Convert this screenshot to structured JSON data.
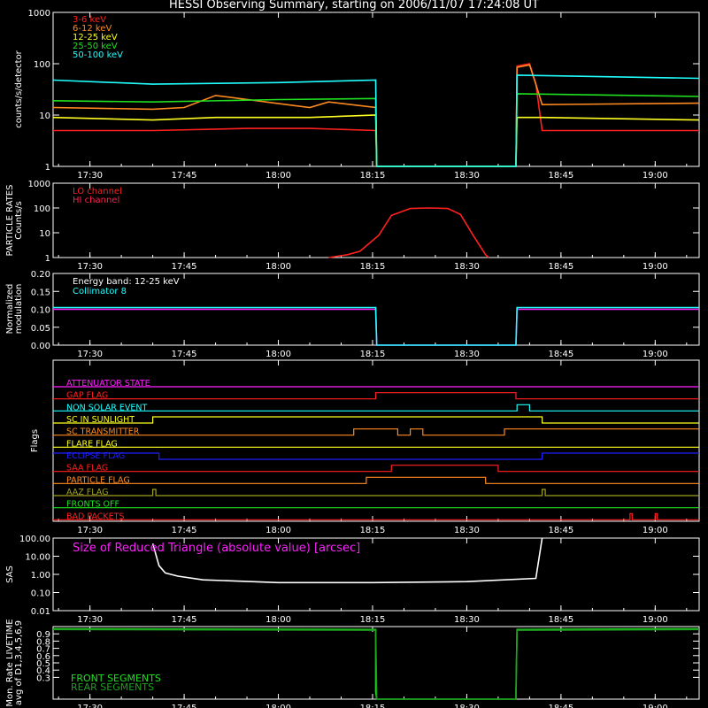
{
  "title": "HESSI Observing Summary, starting on 2006/11/07 17:24:08 UT",
  "colors": {
    "background": "#000000",
    "axes": "#ffffff",
    "red": "#ff2020",
    "orange": "#ff8a20",
    "yellow": "#ffff20",
    "green": "#20e020",
    "cyan": "#20ffff",
    "magenta": "#ff20ff",
    "blue": "#2020ff",
    "crimson": "#ff2050",
    "olive": "#a0a020",
    "darkgreen": "#20a020"
  },
  "time_axis": {
    "start": "17:24:08",
    "end": "19:07:00",
    "tick_labels": [
      "17:30",
      "17:45",
      "18:00",
      "18:15",
      "18:30",
      "18:45",
      "19:00"
    ]
  },
  "chart_data": [
    {
      "id": "count_rates",
      "type": "line",
      "ylabel": "counts/s/detector",
      "yscale": "log",
      "ylim": [
        1,
        1000
      ],
      "ytick_labels": [
        "1",
        "10",
        "100",
        "1000"
      ],
      "series": [
        {
          "name": "3-6 keV",
          "color": "red",
          "x": [
            "17:24:08",
            "17:33",
            "17:40",
            "17:55",
            "18:05",
            "18:15:30",
            "18:15:40",
            "18:37:50",
            "18:38",
            "18:40",
            "18:41",
            "18:42",
            "18:50",
            "19:07"
          ],
          "y": [
            5,
            5,
            5,
            5.5,
            5.5,
            5,
            1,
            1,
            90,
            100,
            40,
            5,
            5,
            5
          ]
        },
        {
          "name": "6-12 keV",
          "color": "orange",
          "x": [
            "17:24:08",
            "17:40",
            "17:45",
            "17:50",
            "18:05",
            "18:08",
            "18:15:30",
            "18:15:40",
            "18:37:50",
            "18:38",
            "18:40",
            "18:41",
            "18:42",
            "19:07"
          ],
          "y": [
            14,
            13,
            14,
            24,
            14,
            18,
            14,
            1,
            1,
            85,
            95,
            40,
            16,
            17
          ]
        },
        {
          "name": "12-25 keV",
          "color": "yellow",
          "x": [
            "17:24:08",
            "17:40",
            "17:50",
            "18:05",
            "18:15:30",
            "18:15:40",
            "18:37:50",
            "18:38",
            "18:42",
            "19:07"
          ],
          "y": [
            9,
            8,
            9,
            9,
            10,
            1,
            1,
            9,
            9,
            8
          ]
        },
        {
          "name": "25-50 keV",
          "color": "green",
          "x": [
            "17:24:08",
            "17:40",
            "18:00",
            "18:15:30",
            "18:15:40",
            "18:37:50",
            "18:38",
            "19:07"
          ],
          "y": [
            19,
            18,
            20,
            21,
            1,
            1,
            26,
            23
          ]
        },
        {
          "name": "50-100 keV",
          "color": "cyan",
          "x": [
            "17:24:08",
            "17:40",
            "18:00",
            "18:15:30",
            "18:15:40",
            "18:37:50",
            "18:38",
            "19:07"
          ],
          "y": [
            48,
            40,
            43,
            48,
            1,
            1,
            60,
            52
          ]
        }
      ]
    },
    {
      "id": "particle_rates",
      "type": "line",
      "ylabel": "PARTICLE RATES",
      "ylabel2": "Counts/s",
      "yscale": "log",
      "ylim": [
        1,
        1000
      ],
      "ytick_labels": [
        "1",
        "10",
        "100",
        "1000"
      ],
      "series": [
        {
          "name": "LO channel",
          "color": "red",
          "x": [
            "18:08",
            "18:11",
            "18:13",
            "18:16",
            "18:18",
            "18:21",
            "18:24",
            "18:27",
            "18:29",
            "18:31",
            "18:33",
            "18:33:30"
          ],
          "y": [
            1,
            1.3,
            1.8,
            8,
            50,
            95,
            100,
            95,
            55,
            8,
            1.3,
            1
          ]
        },
        {
          "name": "HI channel",
          "color": "crimson",
          "x": [],
          "y": []
        }
      ]
    },
    {
      "id": "modulation",
      "type": "line",
      "ylabel": "Normalized",
      "ylabel2": "modulation",
      "ylim": [
        0,
        0.2
      ],
      "ytick_labels": [
        "0.00",
        "0.05",
        "0.10",
        "0.15",
        "0.20"
      ],
      "series": [
        {
          "name": "Energy band: 12-25 keV",
          "color": "magenta",
          "x": [
            "17:24:08",
            "18:15:30",
            "18:15:40",
            "18:37:50",
            "18:38",
            "19:07"
          ],
          "y": [
            0.1,
            0.1,
            0,
            0,
            0.1,
            0.1
          ]
        },
        {
          "name": "Collimator 8",
          "color": "cyan",
          "x": [
            "17:24:08",
            "18:15:30",
            "18:15:40",
            "18:37:50",
            "18:38",
            "19:07"
          ],
          "y": [
            0.105,
            0.105,
            0,
            0,
            0.105,
            0.105
          ]
        }
      ]
    },
    {
      "id": "flags",
      "type": "line",
      "ylabel": "Flags",
      "series": [
        {
          "name": "ATTENUATOR STATE",
          "color": "magenta",
          "x": [
            "17:24:08",
            "19:07"
          ],
          "y": [
            0,
            0
          ]
        },
        {
          "name": "GAP FLAG",
          "color": "red",
          "x": [
            "17:24:08",
            "18:15:30",
            "18:15:30",
            "18:37:50",
            "18:37:50",
            "19:07"
          ],
          "y": [
            0,
            0,
            1,
            1,
            0,
            0
          ]
        },
        {
          "name": "NON SOLAR EVENT",
          "color": "cyan",
          "x": [
            "17:24:08",
            "18:38",
            "18:38",
            "18:40",
            "18:40",
            "19:07"
          ],
          "y": [
            0,
            0,
            1,
            1,
            0,
            0
          ]
        },
        {
          "name": "SC IN SUNLIGHT",
          "color": "yellow",
          "x": [
            "17:24:08",
            "17:40",
            "17:40",
            "18:42",
            "18:42",
            "19:07"
          ],
          "y": [
            0,
            0,
            1,
            1,
            0,
            0
          ]
        },
        {
          "name": "SC TRANSMITTER",
          "color": "orange",
          "x": [
            "17:24:08",
            "18:12",
            "18:12",
            "18:19",
            "18:19",
            "18:21",
            "18:21",
            "18:23",
            "18:23",
            "18:36",
            "18:36",
            "19:07"
          ],
          "y": [
            0,
            0,
            1,
            1,
            0,
            0,
            1,
            1,
            0,
            0,
            1,
            1
          ]
        },
        {
          "name": "FLARE FLAG",
          "color": "yellow",
          "x": [
            "17:24:08",
            "19:07"
          ],
          "y": [
            0,
            0
          ]
        },
        {
          "name": "ECLIPSE FLAG",
          "color": "blue",
          "x": [
            "17:24:08",
            "17:41",
            "17:41",
            "18:42",
            "18:42",
            "19:07"
          ],
          "y": [
            1,
            1,
            0,
            0,
            1,
            1
          ]
        },
        {
          "name": "SAA FLAG",
          "color": "red",
          "x": [
            "17:24:08",
            "18:18",
            "18:18",
            "18:35",
            "18:35",
            "19:07"
          ],
          "y": [
            0,
            0,
            1,
            1,
            0,
            0
          ]
        },
        {
          "name": "PARTICLE FLAG",
          "color": "orange",
          "x": [
            "17:24:08",
            "18:14",
            "18:14",
            "18:33",
            "18:33",
            "19:07"
          ],
          "y": [
            0,
            0,
            1,
            1,
            0,
            0
          ]
        },
        {
          "name": "AAZ FLAG",
          "color": "olive",
          "x": [
            "17:24:08",
            "17:40",
            "17:40",
            "17:40:30",
            "17:40:30",
            "18:42",
            "18:42",
            "18:42:30",
            "18:42:30",
            "19:07"
          ],
          "y": [
            0,
            0,
            1,
            1,
            0,
            0,
            1,
            1,
            0,
            0
          ]
        },
        {
          "name": "FRONTS OFF",
          "color": "green",
          "x": [
            "17:24:08",
            "19:07"
          ],
          "y": [
            0,
            0
          ]
        },
        {
          "name": "BAD PACKETS",
          "color": "red",
          "x": [
            "17:24:08",
            "18:56",
            "18:56",
            "18:56:20",
            "18:56:20",
            "19:00",
            "19:00",
            "19:00:20",
            "19:00:20",
            "19:07"
          ],
          "y": [
            0,
            0,
            1,
            1,
            0,
            0,
            1,
            1,
            0,
            0
          ]
        }
      ]
    },
    {
      "id": "sas",
      "type": "line",
      "ylabel": "SAS",
      "yscale": "log",
      "ylim": [
        0.01,
        100
      ],
      "ytick_labels": [
        "0.01",
        "0.10",
        "1.00",
        "10.00",
        "100.00"
      ],
      "annotation": "Size of Reduced Triangle (absolute value) [arcsec]",
      "series": [
        {
          "name": "Size of Reduced Triangle (absolute value) [arcsec]",
          "color": "white",
          "x": [
            "17:40",
            "17:41",
            "17:42",
            "17:44",
            "17:48",
            "18:00",
            "18:15",
            "18:30",
            "18:41",
            "18:42"
          ],
          "y": [
            50,
            3,
            1.2,
            0.8,
            0.5,
            0.35,
            0.35,
            0.4,
            0.6,
            100
          ]
        }
      ]
    },
    {
      "id": "livetime",
      "type": "line",
      "ylabel": "Mon. Rate LIVETIME",
      "ylabel2": "avg of D1,3,4,5,6,9",
      "ylim": [
        0,
        1
      ],
      "ytick_labels": [
        "0.3",
        "0.4",
        "0.5",
        "0.6",
        "0.7",
        "0.8",
        "0.9"
      ],
      "series": [
        {
          "name": "FRONT SEGMENTS",
          "color": "green",
          "x": [
            "17:24:08",
            "18:15:30",
            "18:15:30",
            "18:15:40",
            "18:37:50",
            "18:37:50",
            "18:38",
            "19:07"
          ],
          "y": [
            0.97,
            0.96,
            0.1,
            0,
            0,
            0.1,
            0.96,
            0.97
          ]
        },
        {
          "name": "REAR SEGMENTS",
          "color": "darkgreen",
          "x": [
            "17:24:08",
            "18:15:30",
            "18:15:40",
            "18:37:50",
            "18:38",
            "19:07"
          ],
          "y": [
            0.96,
            0.95,
            0,
            0,
            0.95,
            0.96
          ]
        }
      ]
    }
  ]
}
